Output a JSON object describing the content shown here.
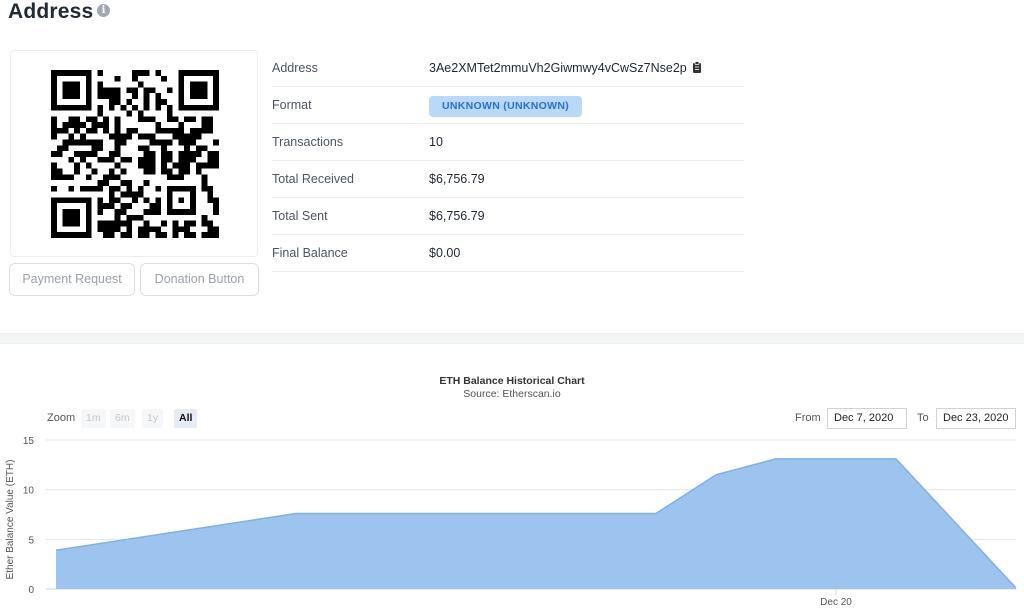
{
  "page": {
    "title": "Address"
  },
  "qr_buttons": {
    "payment_request": "Payment Request",
    "donation_button": "Donation Button"
  },
  "details": {
    "rows": [
      {
        "key": "Address",
        "value": "3Ae2XMTet2mmuVh2Giwmwy4vCwSz7Nse2p"
      },
      {
        "key": "Format",
        "value": "UNKNOWN (UNKNOWN)"
      },
      {
        "key": "Transactions",
        "value": "10"
      },
      {
        "key": "Total Received",
        "value": "$6,756.79"
      },
      {
        "key": "Total Sent",
        "value": "$6,756.79"
      },
      {
        "key": "Final Balance",
        "value": "$0.00"
      }
    ]
  },
  "chart_controls": {
    "zoom_label": "Zoom",
    "zoom_options": [
      "1m",
      "6m",
      "1y",
      "All"
    ],
    "active_zoom": "All",
    "from_label": "From",
    "from_value": "Dec 7, 2020",
    "to_label": "To",
    "to_value": "Dec 23, 2020"
  },
  "colors": {
    "area_fill": "#9cc4ee",
    "area_line": "#7fb0e6",
    "badge_bg": "#b9d9fb",
    "badge_text": "#2b6fd6"
  },
  "chart_data": {
    "type": "area",
    "title": "ETH Balance Historical Chart",
    "subtitle": "Source: Etherscan.io",
    "xlabel": "",
    "ylabel": "Ether Balance Value (ETH)",
    "x_tick_labels": [
      "Dec 20"
    ],
    "y_ticks": [
      0,
      5,
      10,
      15
    ],
    "ylim": [
      0,
      15
    ],
    "grid": true,
    "series": [
      {
        "x": [
          "Dec 7, 2020",
          "Dec 11, 2020",
          "Dec 17, 2020",
          "Dec 18, 2020",
          "Dec 19, 2020",
          "Dec 21, 2020",
          "Dec 23, 2020",
          "Dec 23, 2020"
        ],
        "values": [
          3.9,
          7.6,
          7.6,
          11.5,
          13.1,
          13.1,
          0.1,
          0.1
        ]
      }
    ]
  }
}
